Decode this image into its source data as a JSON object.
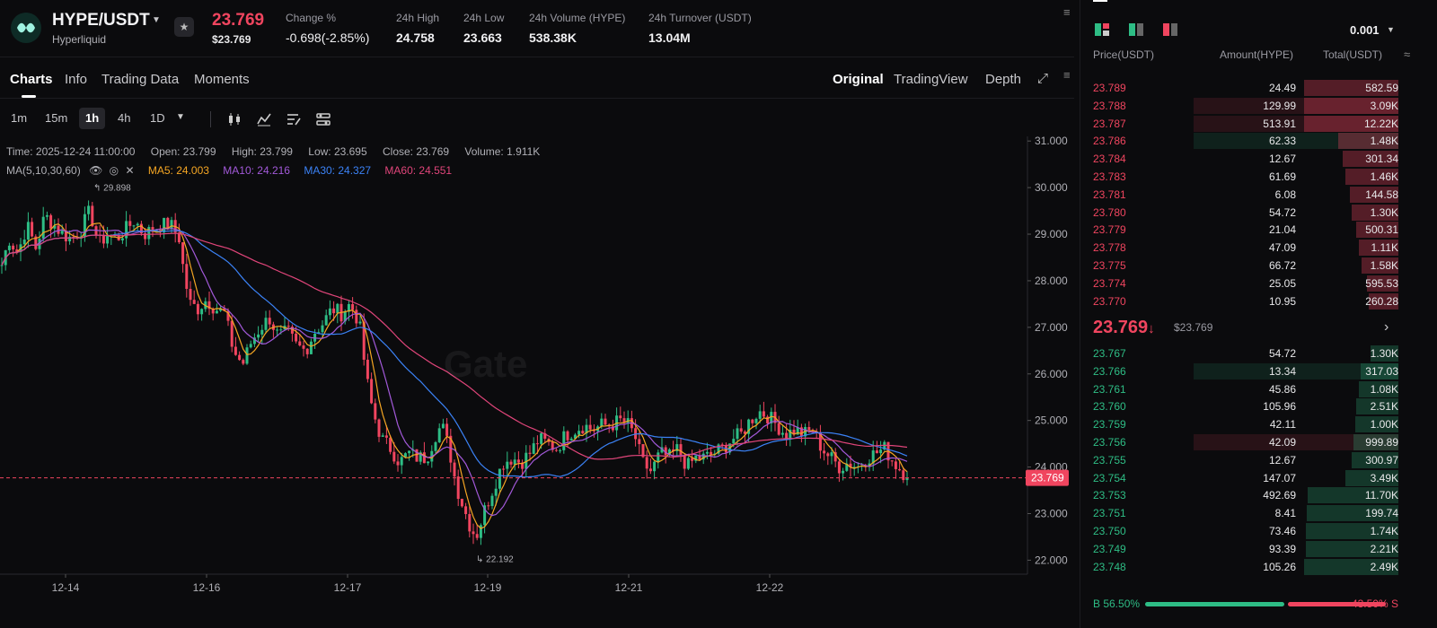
{
  "header": {
    "pair": "HYPE/USDT",
    "network": "Hyperliquid",
    "last_price": "23.769",
    "last_price_usd": "$23.769",
    "stats": [
      {
        "label": "Change %",
        "value": "-0.698(-2.85%)",
        "color": "#f0455f"
      },
      {
        "label": "24h High",
        "value": "24.758"
      },
      {
        "label": "24h Low",
        "value": "23.663"
      },
      {
        "label": "24h Volume (HYPE)",
        "value": "538.38K"
      },
      {
        "label": "24h Turnover (USDT)",
        "value": "13.04M"
      }
    ]
  },
  "tabs": [
    "Charts",
    "Info",
    "Trading Data",
    "Moments"
  ],
  "views": [
    "Original",
    "TradingView",
    "Depth"
  ],
  "timeframes": [
    "1m",
    "15m",
    "1h",
    "4h",
    "1D"
  ],
  "active_timeframe": "1h",
  "legend": {
    "time": "Time: 2025-12-24 11:00:00",
    "open": "Open: 23.799",
    "high": "High: 23.799",
    "low": "Low: 23.695",
    "close": "Close: 23.769",
    "volume": "Volume: 1.911K",
    "ma_label": "MA(5,10,30,60)",
    "ma5": "MA5: 24.003",
    "ma10": "MA10: 24.216",
    "ma30": "MA30: 24.327",
    "ma60": "MA60: 24.551"
  },
  "watermark": "Gate",
  "colors": {
    "up": "#2ebd85",
    "down": "#f0455f",
    "ma5": "#f5a623",
    "ma10": "#a259d9",
    "ma30": "#3b82f6",
    "ma60": "#e0457a"
  },
  "chart_data": {
    "type": "candlestick",
    "x_tick_labels": [
      "12-14",
      "12-16",
      "12-17",
      "12-19",
      "12-21",
      "12-22"
    ],
    "y_tick_labels": [
      "31.000",
      "30.000",
      "29.000",
      "28.000",
      "27.000",
      "26.000",
      "25.000",
      "24.000",
      "23.000",
      "22.000"
    ],
    "ylim": [
      21.7,
      31.1
    ],
    "last_price_label": "23.769",
    "max_annotation": "29.898",
    "min_annotation": "22.192",
    "close_path": [
      [
        0,
        28.2
      ],
      [
        10,
        28.9
      ],
      [
        20,
        28.6
      ],
      [
        30,
        29.2
      ],
      [
        40,
        28.7
      ],
      [
        50,
        29.4
      ],
      [
        60,
        29.2
      ],
      [
        70,
        29.0
      ],
      [
        80,
        28.9
      ],
      [
        90,
        29.1
      ],
      [
        100,
        29.5
      ],
      [
        110,
        28.8
      ],
      [
        120,
        29.0
      ],
      [
        130,
        28.9
      ],
      [
        140,
        29.1
      ],
      [
        150,
        29.3
      ],
      [
        160,
        29.0
      ],
      [
        170,
        29.1
      ],
      [
        180,
        29.2
      ],
      [
        190,
        29.2
      ],
      [
        200,
        28.9
      ],
      [
        205,
        28.1
      ],
      [
        212,
        27.5
      ],
      [
        220,
        27.4
      ],
      [
        230,
        27.6
      ],
      [
        240,
        27.4
      ],
      [
        250,
        27.3
      ],
      [
        260,
        26.5
      ],
      [
        270,
        26.2
      ],
      [
        280,
        26.7
      ],
      [
        290,
        27.0
      ],
      [
        300,
        27.2
      ],
      [
        310,
        26.8
      ],
      [
        320,
        26.9
      ],
      [
        330,
        26.6
      ],
      [
        340,
        26.5
      ],
      [
        350,
        26.9
      ],
      [
        360,
        27.1
      ],
      [
        370,
        27.4
      ],
      [
        380,
        27.3
      ],
      [
        390,
        27.5
      ],
      [
        400,
        27.1
      ],
      [
        408,
        25.9
      ],
      [
        415,
        25.2
      ],
      [
        425,
        24.6
      ],
      [
        435,
        24.4
      ],
      [
        445,
        24.1
      ],
      [
        455,
        24.3
      ],
      [
        465,
        24.2
      ],
      [
        475,
        24.2
      ],
      [
        485,
        24.7
      ],
      [
        492,
        24.9
      ],
      [
        500,
        24.4
      ],
      [
        508,
        23.6
      ],
      [
        515,
        23.2
      ],
      [
        522,
        22.8
      ],
      [
        530,
        22.5
      ],
      [
        540,
        23.1
      ],
      [
        550,
        23.6
      ],
      [
        560,
        24.1
      ],
      [
        570,
        24.2
      ],
      [
        580,
        24.1
      ],
      [
        590,
        24.3
      ],
      [
        600,
        24.6
      ],
      [
        610,
        24.5
      ],
      [
        620,
        24.4
      ],
      [
        630,
        24.7
      ],
      [
        640,
        24.8
      ],
      [
        650,
        24.9
      ],
      [
        660,
        24.8
      ],
      [
        670,
        24.9
      ],
      [
        680,
        24.9
      ],
      [
        690,
        25.0
      ],
      [
        700,
        24.9
      ],
      [
        708,
        24.6
      ],
      [
        715,
        24.1
      ],
      [
        725,
        23.9
      ],
      [
        735,
        24.3
      ],
      [
        745,
        24.2
      ],
      [
        755,
        24.4
      ],
      [
        765,
        24.0
      ],
      [
        775,
        24.2
      ],
      [
        785,
        24.2
      ],
      [
        795,
        24.3
      ],
      [
        805,
        24.4
      ],
      [
        815,
        24.6
      ],
      [
        825,
        24.7
      ],
      [
        835,
        25.0
      ],
      [
        845,
        25.2
      ],
      [
        855,
        25.1
      ],
      [
        865,
        24.9
      ],
      [
        875,
        24.7
      ],
      [
        885,
        24.8
      ],
      [
        895,
        24.7
      ],
      [
        905,
        24.8
      ],
      [
        915,
        24.4
      ],
      [
        925,
        24.2
      ],
      [
        935,
        24.0
      ],
      [
        945,
        24.1
      ],
      [
        955,
        24.0
      ],
      [
        965,
        24.2
      ],
      [
        975,
        24.3
      ],
      [
        985,
        24.4
      ],
      [
        995,
        24.1
      ],
      [
        1005,
        23.9
      ],
      [
        1012,
        23.77
      ]
    ]
  },
  "orderbook": {
    "tick": "0.001",
    "headers": {
      "price": "Price(USDT)",
      "amount": "Amount(HYPE)",
      "total": "Total(USDT)"
    },
    "asks": [
      {
        "price": "23.789",
        "amount": "24.49",
        "total": "582.59",
        "depth": 0.95
      },
      {
        "price": "23.788",
        "amount": "129.99",
        "total": "3.09K",
        "depth": 0.95,
        "hl": true
      },
      {
        "price": "23.787",
        "amount": "513.91",
        "total": "12.22K",
        "depth": 0.95,
        "hl": true
      },
      {
        "price": "23.786",
        "amount": "62.33",
        "total": "1.48K",
        "depth": 0.61,
        "hlg": true
      },
      {
        "price": "23.784",
        "amount": "12.67",
        "total": "301.34",
        "depth": 0.56
      },
      {
        "price": "23.783",
        "amount": "61.69",
        "total": "1.46K",
        "depth": 0.54
      },
      {
        "price": "23.781",
        "amount": "6.08",
        "total": "144.58",
        "depth": 0.49
      },
      {
        "price": "23.780",
        "amount": "54.72",
        "total": "1.30K",
        "depth": 0.47
      },
      {
        "price": "23.779",
        "amount": "21.04",
        "total": "500.31",
        "depth": 0.43
      },
      {
        "price": "23.778",
        "amount": "47.09",
        "total": "1.11K",
        "depth": 0.4
      },
      {
        "price": "23.775",
        "amount": "66.72",
        "total": "1.58K",
        "depth": 0.37
      },
      {
        "price": "23.774",
        "amount": "25.05",
        "total": "595.53",
        "depth": 0.32
      },
      {
        "price": "23.770",
        "amount": "10.95",
        "total": "260.28",
        "depth": 0.3
      }
    ],
    "mid_price": "23.769",
    "mid_arrow": "↓",
    "mid_usd": "$23.769",
    "bids": [
      {
        "price": "23.767",
        "amount": "54.72",
        "total": "1.30K",
        "depth": 0.28
      },
      {
        "price": "23.766",
        "amount": "13.34",
        "total": "317.03",
        "depth": 0.38,
        "hlg": true
      },
      {
        "price": "23.761",
        "amount": "45.86",
        "total": "1.08K",
        "depth": 0.4
      },
      {
        "price": "23.760",
        "amount": "105.96",
        "total": "2.51K",
        "depth": 0.43
      },
      {
        "price": "23.759",
        "amount": "42.11",
        "total": "1.00K",
        "depth": 0.44
      },
      {
        "price": "23.756",
        "amount": "42.09",
        "total": "999.89",
        "depth": 0.45,
        "hlr": true
      },
      {
        "price": "23.755",
        "amount": "12.67",
        "total": "300.97",
        "depth": 0.47
      },
      {
        "price": "23.754",
        "amount": "147.07",
        "total": "3.49K",
        "depth": 0.54
      },
      {
        "price": "23.753",
        "amount": "492.69",
        "total": "11.70K",
        "depth": 0.92
      },
      {
        "price": "23.751",
        "amount": "8.41",
        "total": "199.74",
        "depth": 0.93
      },
      {
        "price": "23.750",
        "amount": "73.46",
        "total": "1.74K",
        "depth": 0.94
      },
      {
        "price": "23.749",
        "amount": "93.39",
        "total": "2.21K",
        "depth": 0.94
      },
      {
        "price": "23.748",
        "amount": "105.26",
        "total": "2.49K",
        "depth": 0.95
      }
    ],
    "ratio": {
      "buy_label": "B 56.50%",
      "sell_label": "43.50% S",
      "buy": 0.565
    }
  }
}
